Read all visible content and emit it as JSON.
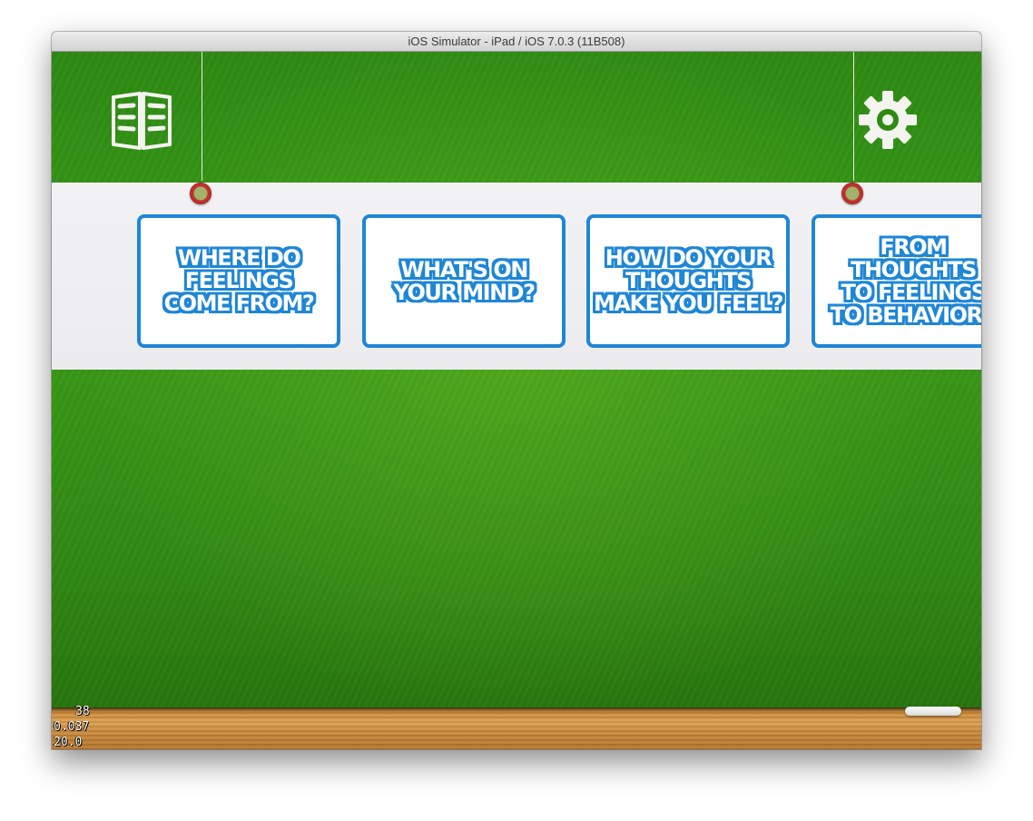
{
  "window": {
    "title": "iOS Simulator - iPad / iOS 7.0.3 (11B508)"
  },
  "toolbar": {
    "left_icon": "book-icon",
    "right_icon": "gear-icon"
  },
  "cards": [
    {
      "label": "WHERE DO\nFEELINGS\nCOME FROM?"
    },
    {
      "label": "WHAT'S ON\nYOUR MIND?"
    },
    {
      "label": "HOW DO YOUR\nTHOUGHTS\nMAKE YOU FEEL?"
    },
    {
      "label": "FROM THOUGHTS\nTO FEELINGS\nTO BEHAVIORS"
    }
  ],
  "debug_stats": {
    "line1": "38",
    "line2": "0.037",
    "line3": "20.0"
  },
  "colors": {
    "chalkboard": "#2f8a12",
    "card_border": "#1e86d6",
    "banner": "#efeff2",
    "tray": "#c98a3a"
  }
}
